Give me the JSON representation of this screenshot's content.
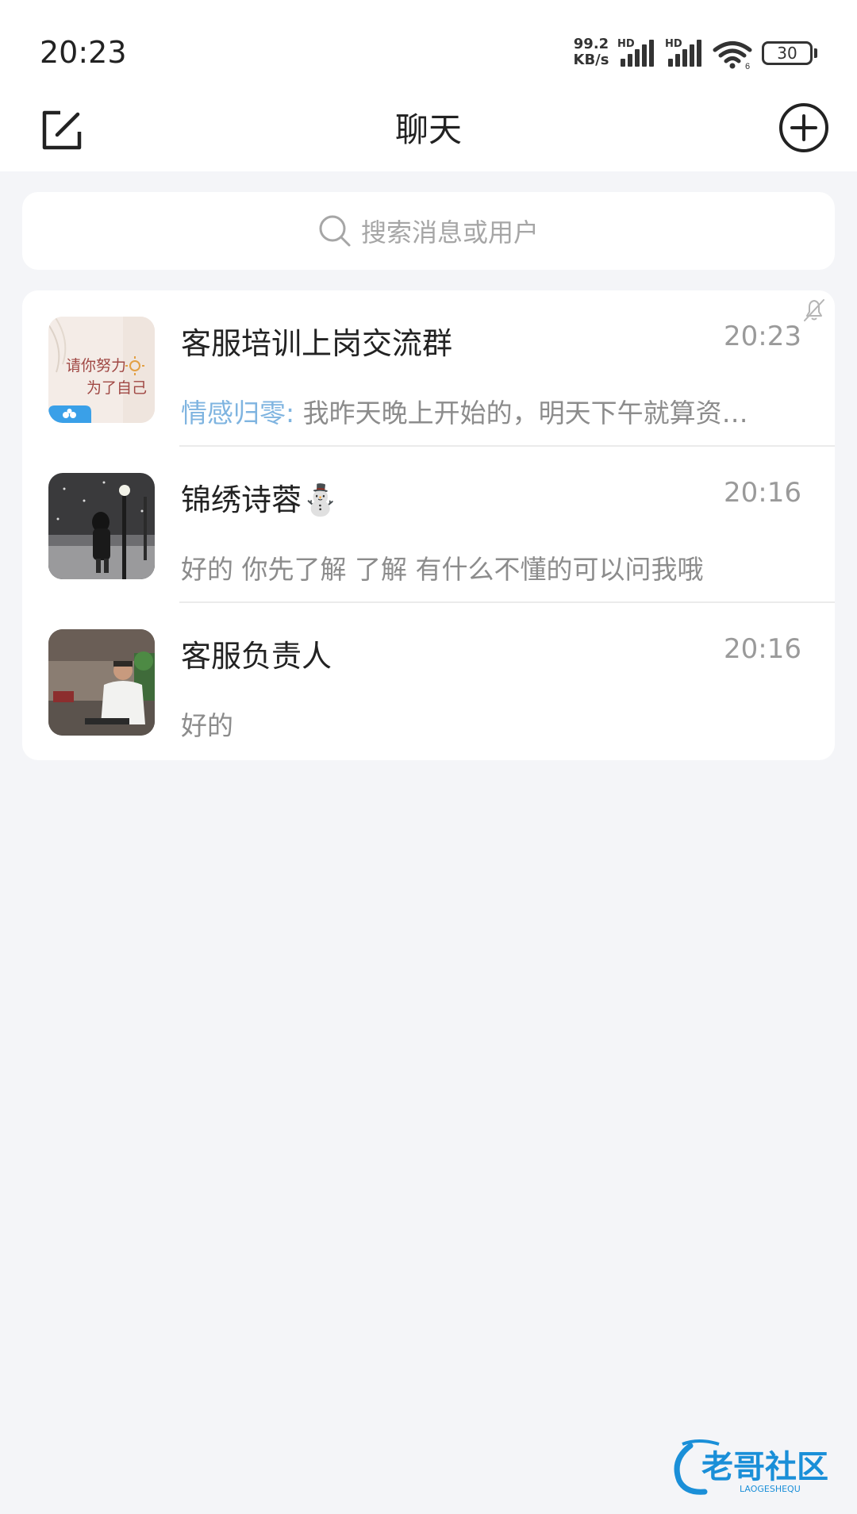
{
  "status_bar": {
    "time": "20:23",
    "net_speed_value": "99.2",
    "net_speed_unit": "KB/s",
    "sim1_label": "HD",
    "sim2_label": "HD",
    "wifi_sub": "6",
    "battery": "30"
  },
  "header": {
    "title": "聊天"
  },
  "search": {
    "placeholder": "搜索消息或用户"
  },
  "chats": [
    {
      "name": "客服培训上岗交流群",
      "time": "20:23",
      "sender": "情感归零:",
      "preview": " 我昨天晚上开始的，明天下午就算资…",
      "muted": true,
      "avatar_text": [
        "请你努力",
        "为了自己"
      ]
    },
    {
      "name": "锦绣诗蓉⛄",
      "time": "20:16",
      "sender": "",
      "preview": "好的 你先了解 了解 有什么不懂的可以问我哦",
      "muted": false
    },
    {
      "name": "客服负责人",
      "time": "20:16",
      "sender": "",
      "preview": "好的",
      "muted": false
    }
  ],
  "watermark": {
    "title": "老哥社区",
    "sub": "LAOGESHEQU"
  },
  "colors": {
    "background": "#f4f5f8",
    "card": "#ffffff",
    "sender_accent": "#7fb4e0",
    "muted_text": "#8c8c8c",
    "watermark_blue": "#1a8fd8"
  }
}
